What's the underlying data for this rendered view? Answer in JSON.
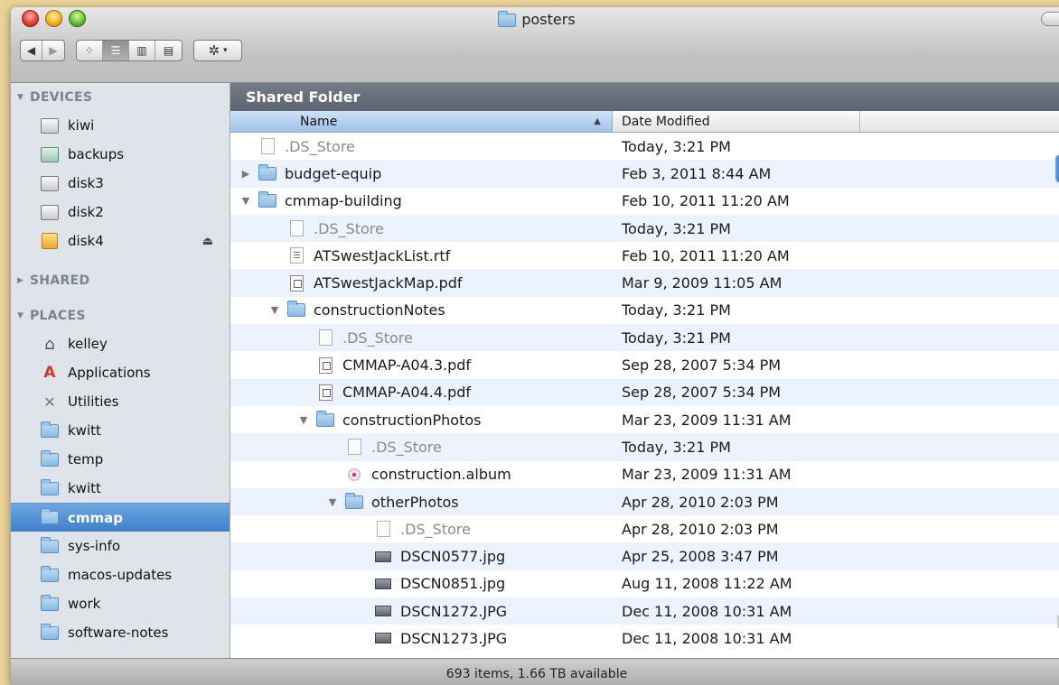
{
  "window": {
    "title": "posters",
    "folder_icon": "folder-icon"
  },
  "toolbar": {
    "back_label": "◀",
    "forward_label": "▶",
    "view_icon_label": "⁘",
    "view_list_label": "☰",
    "view_column_label": "▥",
    "view_coverflow_label": "▤",
    "action_label": "✲",
    "action_caret": "▾"
  },
  "sidebar": {
    "devices_header": "DEVICES",
    "shared_header": "SHARED",
    "places_header": "PLACES",
    "devices": [
      {
        "label": "kiwi",
        "icon": "disk-icon"
      },
      {
        "label": "backups",
        "icon": "network-disk-icon"
      },
      {
        "label": "disk3",
        "icon": "disk-icon"
      },
      {
        "label": "disk2",
        "icon": "disk-icon"
      },
      {
        "label": "disk4",
        "icon": "external-disk-icon",
        "eject": "⏏"
      }
    ],
    "places": [
      {
        "label": "kelley",
        "icon": "home-icon"
      },
      {
        "label": "Applications",
        "icon": "applications-icon"
      },
      {
        "label": "Utilities",
        "icon": "utilities-icon"
      },
      {
        "label": "kwitt",
        "icon": "folder-icon"
      },
      {
        "label": "temp",
        "icon": "folder-icon"
      },
      {
        "label": "kwitt",
        "icon": "folder-icon"
      },
      {
        "label": "cmmap",
        "icon": "folder-icon",
        "selected": true
      },
      {
        "label": "sys-info",
        "icon": "folder-icon"
      },
      {
        "label": "macos-updates",
        "icon": "folder-icon"
      },
      {
        "label": "work",
        "icon": "folder-icon"
      },
      {
        "label": "software-notes",
        "icon": "folder-icon"
      }
    ]
  },
  "main": {
    "header": "Shared Folder",
    "columns": {
      "name": "Name",
      "date": "Date Modified",
      "sort_indicator": "▲"
    },
    "rows": [
      {
        "name": ".DS_Store",
        "date": "Today, 3:21 PM",
        "indent": 0,
        "type": "doc",
        "dim": true,
        "disclosure": ""
      },
      {
        "name": "budget-equip",
        "date": "Feb 3, 2011 8:44 AM",
        "indent": 0,
        "type": "folder",
        "dim": false,
        "disclosure": "▶"
      },
      {
        "name": "cmmap-building",
        "date": "Feb 10, 2011 11:20 AM",
        "indent": 0,
        "type": "folder",
        "dim": false,
        "disclosure": "▼"
      },
      {
        "name": ".DS_Store",
        "date": "Today, 3:21 PM",
        "indent": 1,
        "type": "doc",
        "dim": true,
        "disclosure": ""
      },
      {
        "name": "ATSwestJackList.rtf",
        "date": "Feb 10, 2011 11:20 AM",
        "indent": 1,
        "type": "rtf",
        "dim": false,
        "disclosure": ""
      },
      {
        "name": "ATSwestJackMap.pdf",
        "date": "Mar 9, 2009 11:05 AM",
        "indent": 1,
        "type": "pdf",
        "dim": false,
        "disclosure": ""
      },
      {
        "name": "constructionNotes",
        "date": "Today, 3:21 PM",
        "indent": 1,
        "type": "folder",
        "dim": false,
        "disclosure": "▼"
      },
      {
        "name": ".DS_Store",
        "date": "Today, 3:21 PM",
        "indent": 2,
        "type": "doc",
        "dim": true,
        "disclosure": ""
      },
      {
        "name": "CMMAP-A04.3.pdf",
        "date": "Sep 28, 2007 5:34 PM",
        "indent": 2,
        "type": "pdf",
        "dim": false,
        "disclosure": ""
      },
      {
        "name": "CMMAP-A04.4.pdf",
        "date": "Sep 28, 2007 5:34 PM",
        "indent": 2,
        "type": "pdf",
        "dim": false,
        "disclosure": ""
      },
      {
        "name": "constructionPhotos",
        "date": "Mar 23, 2009 11:31 AM",
        "indent": 2,
        "type": "folder",
        "dim": false,
        "disclosure": "▼"
      },
      {
        "name": ".DS_Store",
        "date": "Today, 3:21 PM",
        "indent": 3,
        "type": "doc",
        "dim": true,
        "disclosure": ""
      },
      {
        "name": "construction.album",
        "date": "Mar 23, 2009 11:31 AM",
        "indent": 3,
        "type": "album",
        "dim": false,
        "disclosure": ""
      },
      {
        "name": "otherPhotos",
        "date": "Apr 28, 2010 2:03 PM",
        "indent": 3,
        "type": "folder",
        "dim": false,
        "disclosure": "▼"
      },
      {
        "name": ".DS_Store",
        "date": "Apr 28, 2010 2:03 PM",
        "indent": 4,
        "type": "doc",
        "dim": true,
        "disclosure": ""
      },
      {
        "name": "DSCN0577.jpg",
        "date": "Apr 25, 2008 3:47 PM",
        "indent": 4,
        "type": "image",
        "dim": false,
        "disclosure": ""
      },
      {
        "name": "DSCN0851.jpg",
        "date": "Aug 11, 2008 11:22 AM",
        "indent": 4,
        "type": "image",
        "dim": false,
        "disclosure": ""
      },
      {
        "name": "DSCN1272.JPG",
        "date": "Dec 11, 2008 10:31 AM",
        "indent": 4,
        "type": "image",
        "dim": false,
        "disclosure": ""
      },
      {
        "name": "DSCN1273.JPG",
        "date": "Dec 11, 2008 10:31 AM",
        "indent": 4,
        "type": "image",
        "dim": false,
        "disclosure": ""
      }
    ]
  },
  "status": {
    "text": "693 items, 1.66 TB available"
  },
  "colors": {
    "selection": "#3f7fcb",
    "stripe": "#edf3fe",
    "sidebar_bg": "#dfe4ea",
    "desktop": "#ead49a"
  }
}
